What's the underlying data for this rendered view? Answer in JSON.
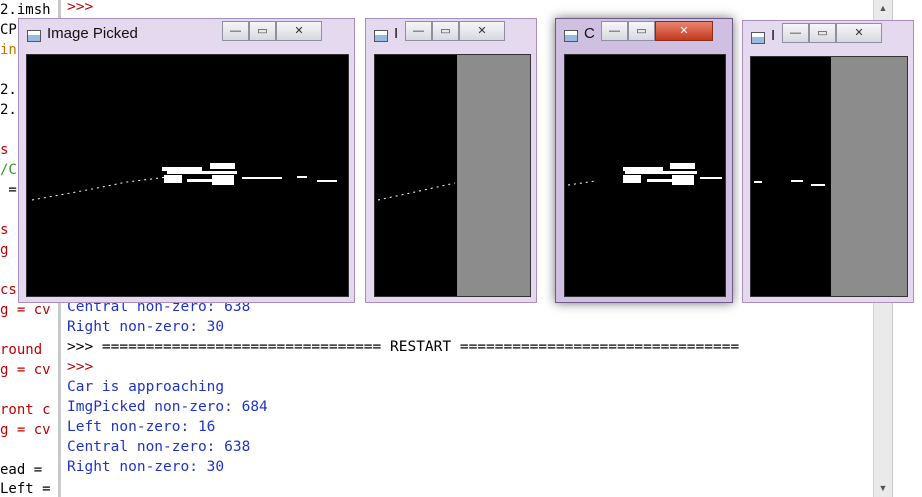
{
  "editor": {
    "lines": [
      {
        "text": "2.imsh",
        "color": "#000000"
      },
      {
        "text": "CP",
        "color": "#000000"
      },
      {
        "text": "in",
        "color": "#c77700"
      },
      {
        "text": "2.",
        "color": "#000000"
      },
      {
        "text": "2.",
        "color": "#000000"
      },
      {
        "text": "s",
        "color": "#c00000"
      },
      {
        "text": "/C",
        "color": "#2a9a2a"
      },
      {
        "text": " =",
        "color": "#000000"
      },
      {
        "text": "s",
        "color": "#c00000"
      },
      {
        "text": "g",
        "color": "#c00000"
      },
      {
        "text": "cs",
        "color": "#c00000"
      },
      {
        "text": "g = cv",
        "color": "#c00000"
      },
      {
        "text": "round",
        "color": "#c00000"
      },
      {
        "text": "g = cv",
        "color": "#c00000"
      },
      {
        "text": "ront c",
        "color": "#c00000"
      },
      {
        "text": "g = cv",
        "color": "#c00000"
      },
      {
        "text": "ead =",
        "color": "#000000"
      },
      {
        "text": "Left =",
        "color": "#000000"
      }
    ]
  },
  "shell": {
    "lines": [
      {
        "text": ">>>",
        "cls": "prompt"
      },
      {
        "text": "Central non-zero: 638",
        "cls": "out"
      },
      {
        "text": "Right non-zero: 30",
        "cls": "out"
      },
      {
        "text": ">>> ================================ RESTART ================================",
        "cls": "plain"
      },
      {
        "text": ">>>",
        "cls": "prompt"
      },
      {
        "text": "Car is approaching",
        "cls": "out"
      },
      {
        "text": "ImgPicked non-zero: 684",
        "cls": "out"
      },
      {
        "text": "Left non-zero: 16",
        "cls": "out"
      },
      {
        "text": "Central non-zero: 638",
        "cls": "out"
      },
      {
        "text": "Right non-zero: 30",
        "cls": "out"
      }
    ]
  },
  "windows": [
    {
      "title": "Image Picked",
      "active": false
    },
    {
      "title": "I",
      "active": false
    },
    {
      "title": "C",
      "active": true
    },
    {
      "title": "I",
      "active": false
    }
  ],
  "icons": {
    "minimize": "minimize-icon",
    "maximize": "maximize-icon",
    "close": "close-icon",
    "scroll_up": "scroll-up-icon",
    "scroll_down": "scroll-down-icon"
  },
  "glyphs": {
    "minimize": "—",
    "maximize": "▭",
    "close": "✕",
    "up": "▲",
    "down": "▼"
  },
  "colors": {
    "prompt": "#c00000",
    "output": "#1f34c6",
    "window_frame": "#e5d9ef",
    "close_hot": "#c33a20"
  }
}
